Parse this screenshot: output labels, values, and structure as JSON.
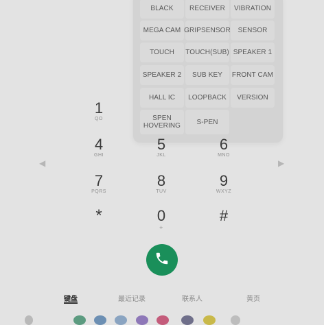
{
  "test_menu": {
    "buttons": [
      "BLACK",
      "RECEIVER",
      "VIBRATION",
      "MEGA CAM",
      "GRIPSENSOR",
      "SENSOR",
      "TOUCH",
      "TOUCH(SUB)",
      "SPEAKER 1",
      "SPEAKER 2",
      "SUB KEY",
      "FRONT CAM",
      "HALL IC",
      "LOOPBACK",
      "VERSION",
      "SPEN HOVERING",
      "S-PEN"
    ]
  },
  "dialpad": {
    "keys": [
      {
        "digit": "1",
        "letters": "QO"
      },
      {
        "digit": "4",
        "letters": "GHI"
      },
      {
        "digit": "5",
        "letters": "JKL"
      },
      {
        "digit": "6",
        "letters": "MNO"
      },
      {
        "digit": "7",
        "letters": "PQRS"
      },
      {
        "digit": "8",
        "letters": "TUV"
      },
      {
        "digit": "9",
        "letters": "WXYZ"
      },
      {
        "digit": "*",
        "letters": ""
      },
      {
        "digit": "0",
        "letters": "+"
      },
      {
        "digit": "#",
        "letters": ""
      }
    ]
  },
  "icons": {
    "call": "phone-icon",
    "left_arrow": "chevron-left-icon",
    "right_arrow": "chevron-right-icon"
  },
  "colors": {
    "call_button": "#1a8f5a",
    "background": "#e3e3e3"
  },
  "tabs": [
    {
      "label": "键盘",
      "active": true
    },
    {
      "label": "最近记录",
      "active": false
    },
    {
      "label": "联系人",
      "active": false
    },
    {
      "label": "黄页",
      "active": false
    }
  ]
}
